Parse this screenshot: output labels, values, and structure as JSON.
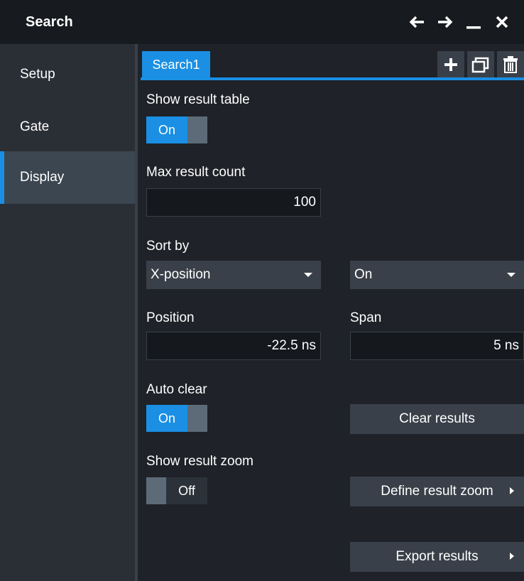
{
  "window": {
    "title": "Search"
  },
  "sidebar": {
    "items": [
      {
        "label": "Setup"
      },
      {
        "label": "Gate"
      },
      {
        "label": "Display"
      }
    ]
  },
  "tabs": [
    {
      "label": "Search1"
    }
  ],
  "display": {
    "show_result_table": {
      "label": "Show result table",
      "value": "On"
    },
    "max_result_count": {
      "label": "Max result count",
      "value": "100"
    },
    "sort_by": {
      "label": "Sort by",
      "value": "X-position",
      "order": "On"
    },
    "position": {
      "label": "Position",
      "value": "-22.5 ns"
    },
    "span": {
      "label": "Span",
      "value": "5 ns"
    },
    "auto_clear": {
      "label": "Auto clear",
      "value": "On"
    },
    "clear_results": {
      "label": "Clear results"
    },
    "show_result_zoom": {
      "label": "Show result zoom",
      "value": "Off"
    },
    "define_result_zoom": {
      "label": "Define result zoom"
    },
    "export_results": {
      "label": "Export results"
    }
  },
  "colors": {
    "accent": "#1a8fe3",
    "background": "#1f2228",
    "sidebar": "#2a2f36",
    "control": "#3a4049"
  }
}
